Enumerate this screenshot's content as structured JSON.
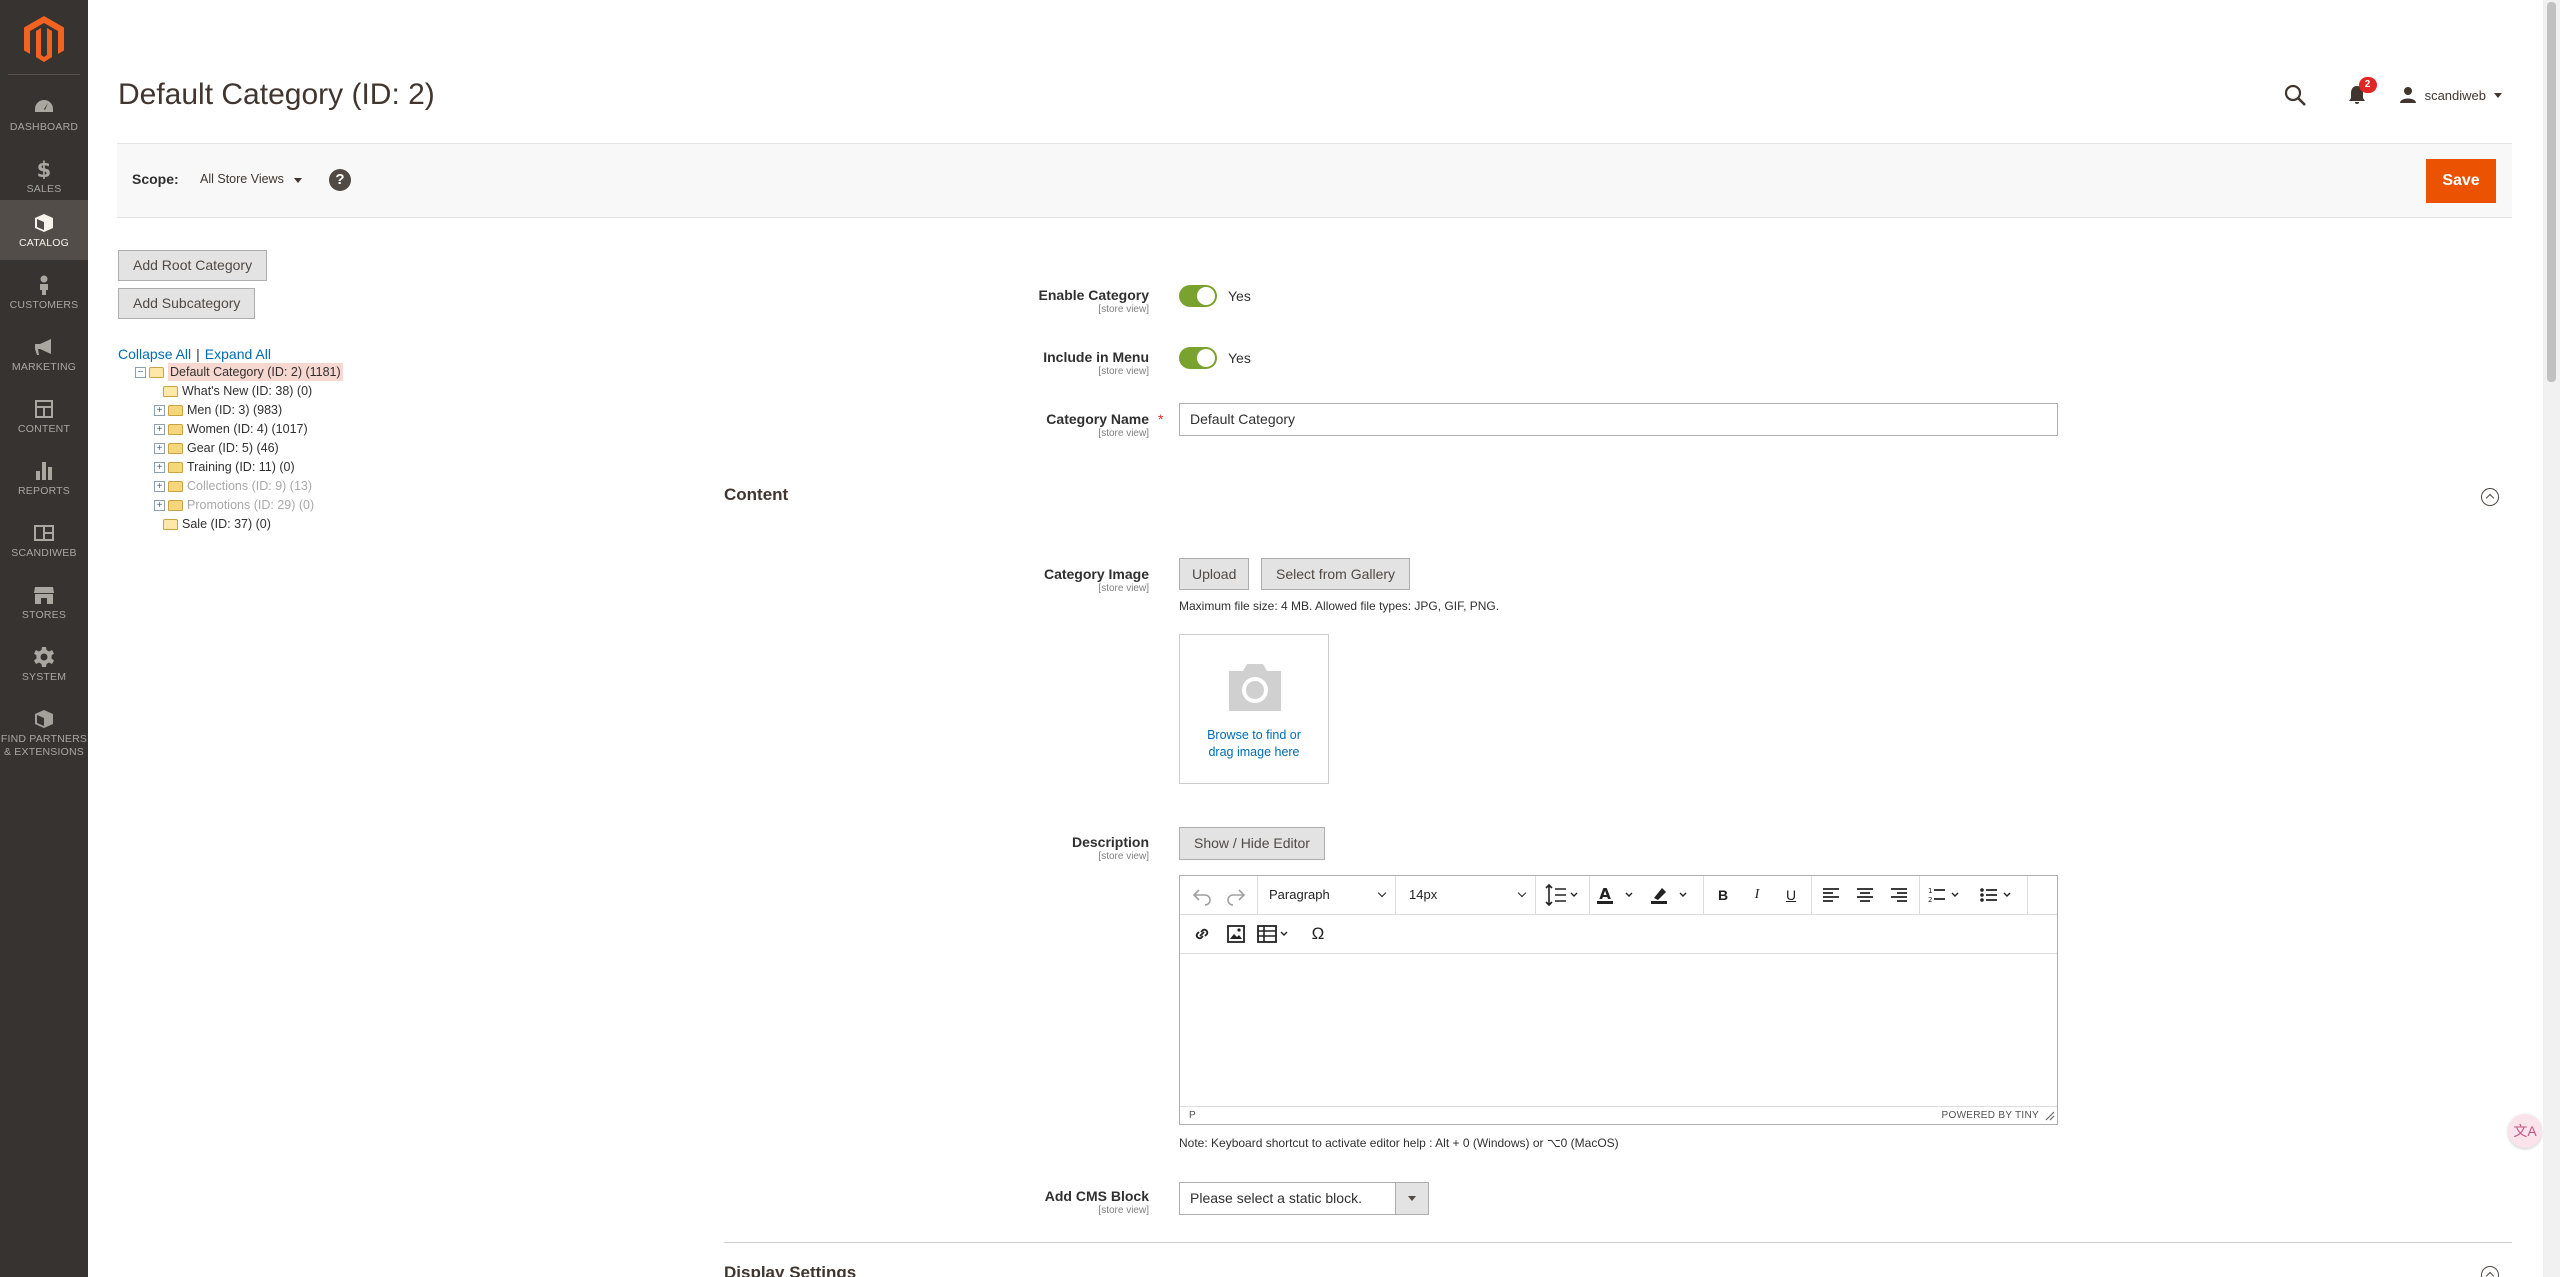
{
  "sidebar": {
    "logo": "magento-logo",
    "items": [
      {
        "label": "DASHBOARD",
        "icon": "dashboard-icon"
      },
      {
        "label": "SALES",
        "icon": "dollar-icon"
      },
      {
        "label": "CATALOG",
        "icon": "box-icon",
        "active": true
      },
      {
        "label": "CUSTOMERS",
        "icon": "person-icon"
      },
      {
        "label": "MARKETING",
        "icon": "megaphone-icon"
      },
      {
        "label": "CONTENT",
        "icon": "layout-icon"
      },
      {
        "label": "REPORTS",
        "icon": "bar-chart-icon"
      },
      {
        "label": "SCANDIWEB",
        "icon": "scandiweb-icon"
      },
      {
        "label": "STORES",
        "icon": "store-icon"
      },
      {
        "label": "SYSTEM",
        "icon": "gear-icon"
      },
      {
        "label": "FIND PARTNERS & EXTENSIONS",
        "icon": "cube-icon"
      }
    ]
  },
  "header": {
    "title": "Default Category (ID: 2)",
    "notifications_count": "2",
    "username": "scandiweb"
  },
  "scope_bar": {
    "label": "Scope:",
    "value": "All Store Views",
    "help": "?",
    "save_label": "Save"
  },
  "tree": {
    "add_root_label": "Add Root Category",
    "add_sub_label": "Add Subcategory",
    "collapse_all": "Collapse All",
    "separator": "|",
    "expand_all": "Expand All",
    "nodes": [
      {
        "label": "Default Category (ID: 2) (1181)"
      },
      {
        "label": "What's New (ID: 38) (0)"
      },
      {
        "label": "Men (ID: 3) (983)"
      },
      {
        "label": "Women (ID: 4) (1017)"
      },
      {
        "label": "Gear (ID: 5) (46)"
      },
      {
        "label": "Training (ID: 11) (0)"
      },
      {
        "label": "Collections (ID: 9) (13)"
      },
      {
        "label": "Promotions (ID: 29) (0)"
      },
      {
        "label": "Sale (ID: 37) (0)"
      }
    ]
  },
  "form": {
    "store_view": "[store view]",
    "enable_category": {
      "label": "Enable Category",
      "value": "Yes"
    },
    "include_in_menu": {
      "label": "Include in Menu",
      "value": "Yes"
    },
    "category_name": {
      "label": "Category Name",
      "value": "Default Category"
    },
    "content_section": "Content",
    "category_image": {
      "label": "Category Image",
      "upload": "Upload",
      "gallery": "Select from Gallery",
      "note": "Maximum file size: 4 MB. Allowed file types: JPG, GIF, PNG.",
      "browse_line1": "Browse to find or",
      "browse_line2": "drag image here"
    },
    "description": {
      "label": "Description",
      "toggle": "Show / Hide Editor",
      "block_format": "Paragraph",
      "font_size": "14px",
      "status_path": "P",
      "powered_by": "POWERED BY TINY",
      "note": "Note: Keyboard shortcut to activate editor help : Alt + 0 (Windows) or ⌥0 (MacOS)"
    },
    "cms_block": {
      "label": "Add CMS Block",
      "placeholder": "Please select a static block."
    },
    "display_section": "Display Settings"
  },
  "colors": {
    "sidebar": "#373330",
    "accent": "#eb5202",
    "toggle_on": "#79a22e",
    "link": "#006bb4"
  }
}
